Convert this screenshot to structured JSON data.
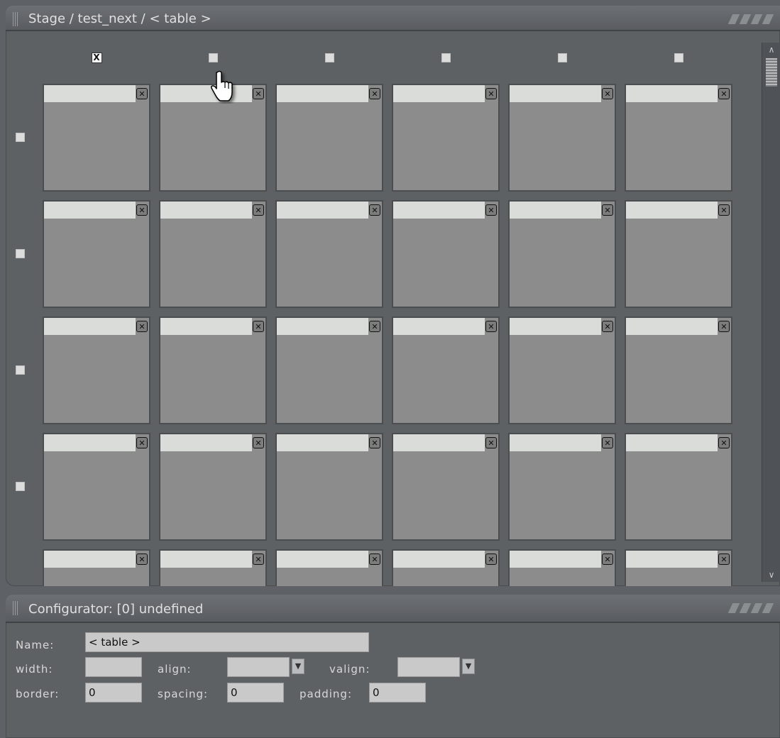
{
  "stage": {
    "title": "Stage / test_next / < table >",
    "rows_visible": 5,
    "columns": 6
  },
  "configurator": {
    "title": "Configurator: [0] undefined",
    "name_label": "Name:",
    "name_value": "< table >",
    "width_label": "width:",
    "width_value": "",
    "align_label": "align:",
    "align_value": "",
    "valign_label": "valign:",
    "valign_value": "",
    "border_label": "border:",
    "border_value": "0",
    "spacing_label": "spacing:",
    "spacing_value": "0",
    "padding_label": "padding:",
    "padding_value": "0"
  },
  "icons": {
    "cell_remove": "close-box-icon",
    "column_selected_mark": "X"
  },
  "colors": {
    "panel_bg": "#5e6164",
    "cell_bg": "#8c8c8c",
    "cell_header": "#dadcd9",
    "field_bg": "#c9c9c9"
  }
}
